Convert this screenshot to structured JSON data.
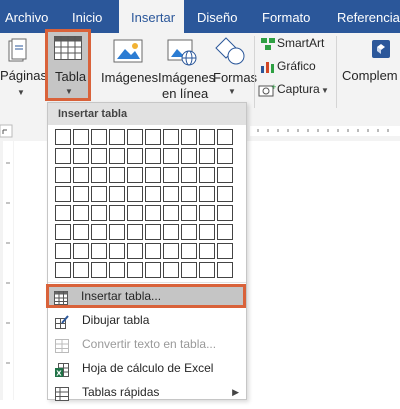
{
  "tabs": [
    "Archivo",
    "Inicio",
    "Insertar",
    "Diseño",
    "Formato",
    "Referencias"
  ],
  "active_tab": "Insertar",
  "ribbon": {
    "paginas_label": "Páginas",
    "tabla_label": "Tabla",
    "imagenes_label": "Imágenes",
    "imagenes_linea_label_1": "Imágenes",
    "imagenes_linea_label_2": "en línea",
    "formas_label": "Formas",
    "smartart_label": "SmartArt",
    "grafico_label": "Gráfico",
    "captura_label": "Captura",
    "complementos_label": "Complem"
  },
  "dropdown": {
    "header": "Insertar tabla",
    "grid_columns": 10,
    "grid_rows": 8,
    "items": [
      {
        "label": "Insertar tabla...",
        "icon": "table-icon",
        "enabled": true,
        "highlighted": true
      },
      {
        "label": "Dibujar tabla",
        "icon": "draw-table-icon",
        "enabled": true,
        "highlighted": false
      },
      {
        "label": "Convertir texto en tabla...",
        "icon": "convert-text-icon",
        "enabled": false,
        "highlighted": false
      },
      {
        "label": "Hoja de cálculo de Excel",
        "icon": "excel-icon",
        "enabled": true,
        "highlighted": false
      },
      {
        "label": "Tablas rápidas",
        "icon": "quick-tables-icon",
        "enabled": true,
        "highlighted": false,
        "submenu": true
      }
    ]
  },
  "colors": {
    "tab_bar": "#2b579a",
    "ribbon_bg": "#f3f3f3",
    "highlight_border": "#d9623a",
    "highlight_fill": "#c5c5c5"
  }
}
